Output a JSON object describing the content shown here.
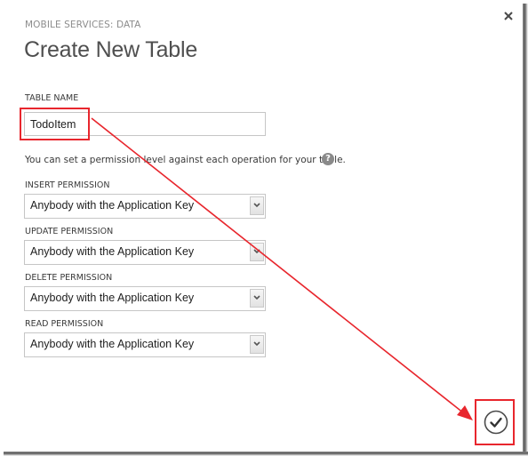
{
  "dialog": {
    "eyebrow": "MOBILE SERVICES: DATA",
    "title": "Create New Table",
    "close_icon": "close-icon",
    "confirm_icon": "checkmark-circle-icon"
  },
  "table_name": {
    "label": "TABLE NAME",
    "value": "TodoItem",
    "placeholder": ""
  },
  "permissions": {
    "description": "You can set a permission level against each operation for your table.",
    "help_icon": "help-icon",
    "help_glyph": "?",
    "fields": [
      {
        "label": "INSERT PERMISSION",
        "value": "Anybody with the Application Key"
      },
      {
        "label": "UPDATE PERMISSION",
        "value": "Anybody with the Application Key"
      },
      {
        "label": "DELETE PERMISSION",
        "value": "Anybody with the Application Key"
      },
      {
        "label": "READ PERMISSION",
        "value": "Anybody with the Application Key"
      }
    ]
  },
  "annotations": {
    "color": "#e8262d",
    "highlighted": [
      "table-name-input",
      "confirm-button"
    ],
    "arrow": "from table name to confirm button"
  },
  "colors": {
    "title_text": "#4f4f4f",
    "eyebrow_text": "#8c8c8c",
    "annotation_red": "#e8262d",
    "help_icon_bg": "#8a8a8a"
  }
}
